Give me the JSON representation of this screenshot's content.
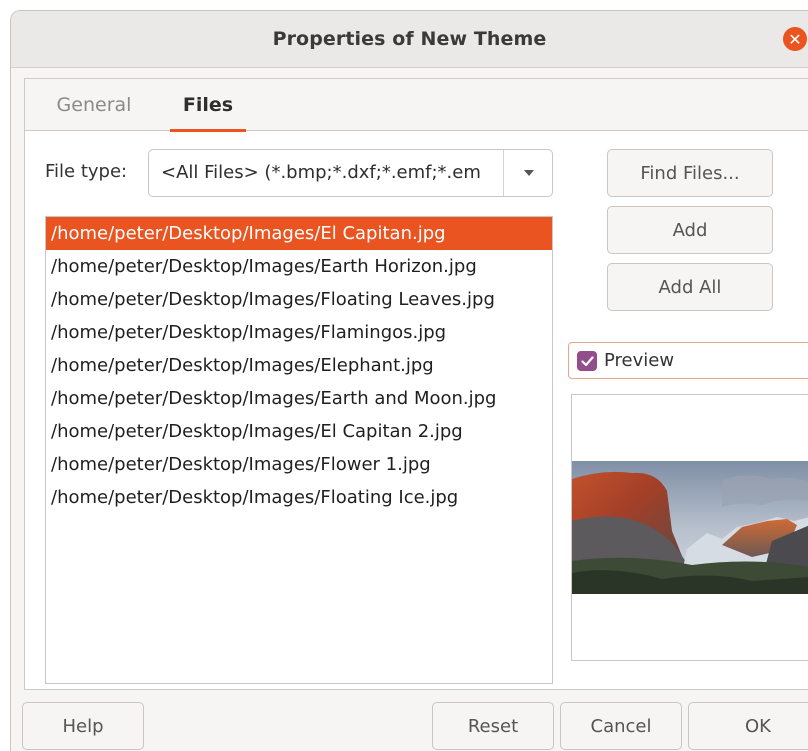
{
  "window": {
    "title": "Properties of New Theme",
    "close_icon": "close-icon"
  },
  "tabs": [
    {
      "label": "General",
      "active": false
    },
    {
      "label": "Files",
      "active": true
    }
  ],
  "file_type": {
    "label": "File type:",
    "value": "<All Files> (*.bmp;*.dxf;*.emf;*.em"
  },
  "files": [
    "/home/peter/Desktop/Images/El Capitan.jpg",
    "/home/peter/Desktop/Images/Earth Horizon.jpg",
    "/home/peter/Desktop/Images/Floating Leaves.jpg",
    "/home/peter/Desktop/Images/Flamingos.jpg",
    "/home/peter/Desktop/Images/Elephant.jpg",
    "/home/peter/Desktop/Images/Earth and Moon.jpg",
    "/home/peter/Desktop/Images/El Capitan 2.jpg",
    "/home/peter/Desktop/Images/Flower 1.jpg",
    "/home/peter/Desktop/Images/Floating Ice.jpg"
  ],
  "selected_file_index": 0,
  "side_buttons": {
    "find_files": "Find Files...",
    "add": "Add",
    "add_all": "Add All"
  },
  "preview": {
    "label": "Preview",
    "checked": true
  },
  "footer": {
    "help": "Help",
    "reset": "Reset",
    "cancel": "Cancel",
    "ok": "OK"
  },
  "colors": {
    "accent": "#e95420",
    "checkbox": "#924d8b"
  }
}
